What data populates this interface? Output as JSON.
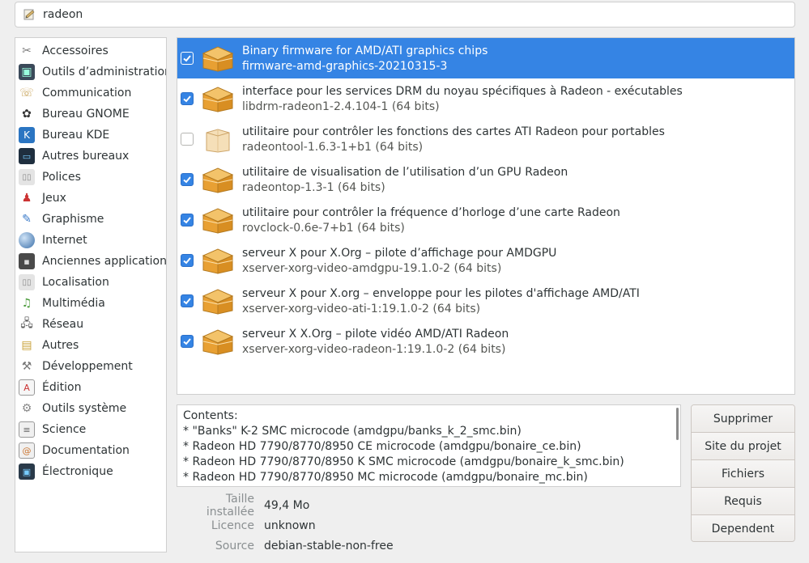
{
  "search": {
    "value": "radeon"
  },
  "categories": [
    {
      "label": "Accessoires",
      "icon": "scissors-icon"
    },
    {
      "label": "Outils d’administration",
      "icon": "monitor-admin-icon"
    },
    {
      "label": "Communication",
      "icon": "phone-icon"
    },
    {
      "label": "Bureau GNOME",
      "icon": "gnome-foot-icon"
    },
    {
      "label": "Bureau KDE",
      "icon": "kde-gear-icon"
    },
    {
      "label": "Autres bureaux",
      "icon": "desktop-icon"
    },
    {
      "label": "Polices",
      "icon": "font-icon"
    },
    {
      "label": "Jeux",
      "icon": "joystick-icon"
    },
    {
      "label": "Graphisme",
      "icon": "paintbrush-icon"
    },
    {
      "label": "Internet",
      "icon": "globe-icon"
    },
    {
      "label": "Anciennes applications",
      "icon": "floppy-icon"
    },
    {
      "label": "Localisation",
      "icon": "locale-icon"
    },
    {
      "label": "Multimédia",
      "icon": "music-note-icon"
    },
    {
      "label": "Réseau",
      "icon": "network-icon"
    },
    {
      "label": "Autres",
      "icon": "folder-icon"
    },
    {
      "label": "Développement",
      "icon": "hammer-icon"
    },
    {
      "label": "Édition",
      "icon": "text-editor-icon"
    },
    {
      "label": "Outils système",
      "icon": "system-gear-icon"
    },
    {
      "label": "Science",
      "icon": "science-icon"
    },
    {
      "label": "Documentation",
      "icon": "help-doc-icon"
    },
    {
      "label": "Électronique",
      "icon": "electronics-icon"
    }
  ],
  "packages": [
    {
      "description": "Binary firmware for AMD/ATI graphics chips",
      "name": "firmware-amd-graphics-20210315-3",
      "checked": true,
      "selected": true
    },
    {
      "description": "interface pour les services DRM du noyau spécifiques à Radeon - exécutables",
      "name": "libdrm-radeon1-2.4.104-1 (64 bits)",
      "checked": true,
      "selected": false
    },
    {
      "description": "utilitaire pour contrôler les fonctions des cartes ATI Radeon pour portables",
      "name": "radeontool-1.6.3-1+b1 (64 bits)",
      "checked": false,
      "selected": false
    },
    {
      "description": "utilitaire de visualisation de l’utilisation d’un GPU Radeon",
      "name": "radeontop-1.3-1 (64 bits)",
      "checked": true,
      "selected": false
    },
    {
      "description": "utilitaire pour contrôler la fréquence d’horloge d’une carte Radeon",
      "name": "rovclock-0.6e-7+b1 (64 bits)",
      "checked": true,
      "selected": false
    },
    {
      "description": "serveur X pour X.Org – pilote d’affichage pour AMDGPU",
      "name": "xserver-xorg-video-amdgpu-19.1.0-2 (64 bits)",
      "checked": true,
      "selected": false
    },
    {
      "description": "serveur X pour X.org – enveloppe pour les pilotes d'affichage AMD/ATI",
      "name": "xserver-xorg-video-ati-1:19.1.0-2 (64 bits)",
      "checked": true,
      "selected": false
    },
    {
      "description": "serveur X X.Org – pilote vidéo AMD/ATI Radeon",
      "name": "xserver-xorg-video-radeon-1:19.1.0-2 (64 bits)",
      "checked": true,
      "selected": false
    }
  ],
  "contents": {
    "lines": [
      "Contents:",
      " * \"Banks\" K-2 SMC microcode (amdgpu/banks_k_2_smc.bin)",
      " * Radeon HD 7790/8770/8950 CE microcode (amdgpu/bonaire_ce.bin)",
      " * Radeon HD 7790/8770/8950 K SMC microcode (amdgpu/bonaire_k_smc.bin)",
      " * Radeon HD 7790/8770/8950 MC microcode (amdgpu/bonaire_mc.bin)"
    ]
  },
  "details": {
    "size_label": "Taille installée",
    "size_value": "49,4 Mo",
    "license_label": "Licence",
    "license_value": "unknown",
    "source_label": "Source",
    "source_value": "debian-stable-non-free"
  },
  "actions": {
    "remove": "Supprimer",
    "website": "Site du projet",
    "files": "Fichiers",
    "requires": "Requis",
    "depends": "Dependent"
  },
  "colors": {
    "selection": "#3584e4",
    "box": "#e8a033"
  }
}
